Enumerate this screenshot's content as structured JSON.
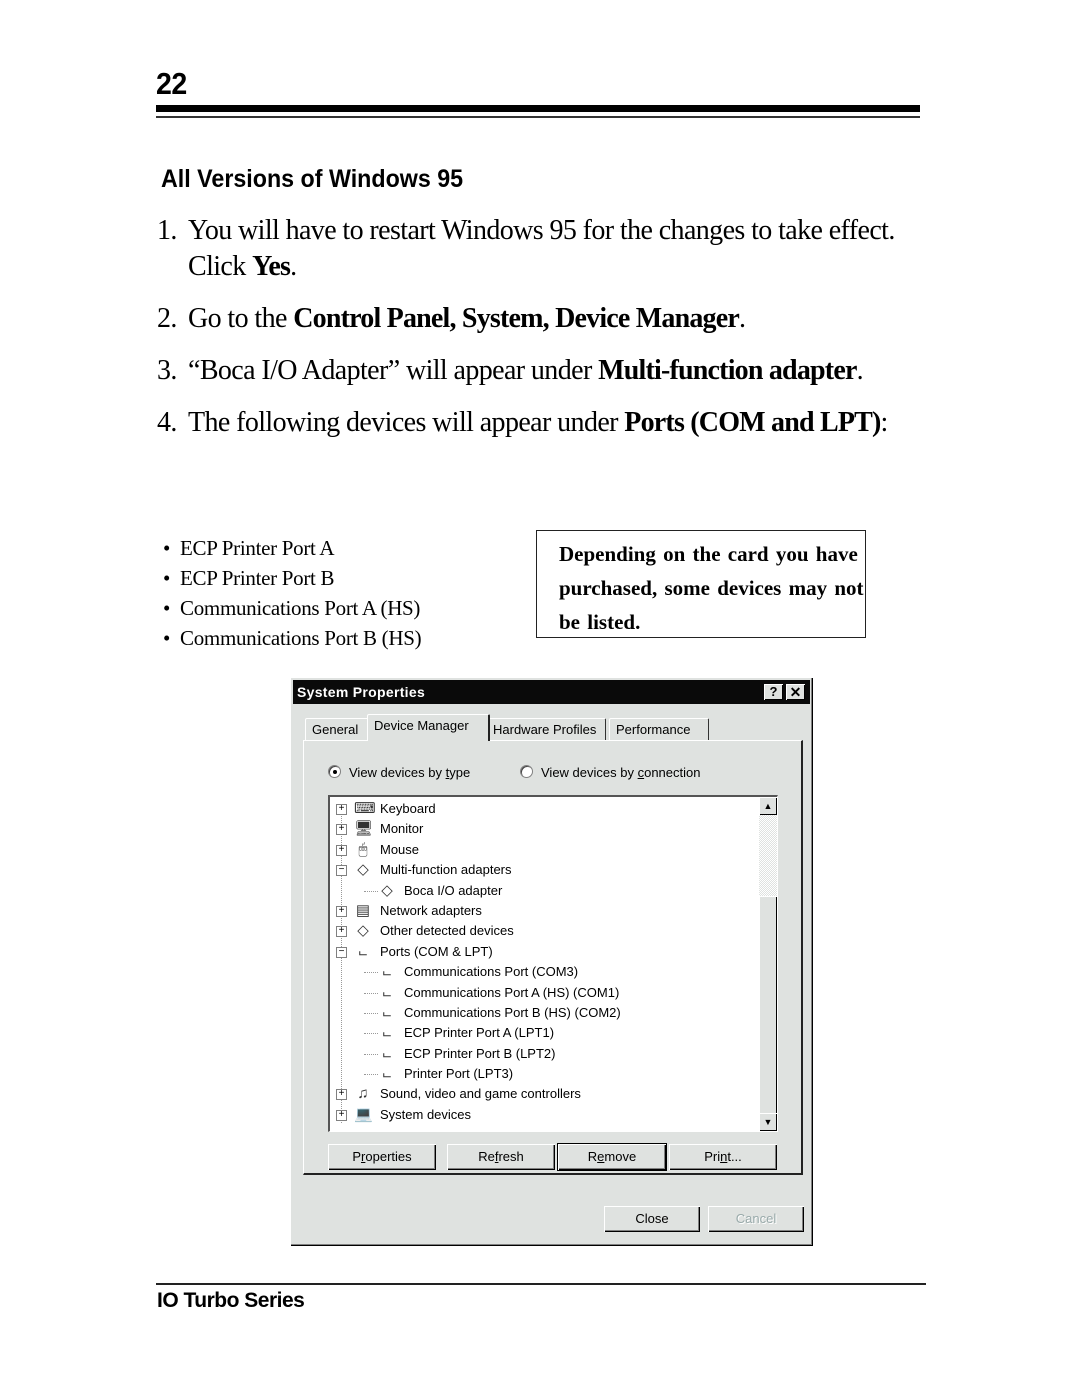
{
  "page": {
    "number": "22",
    "section_heading": "All Versions of Windows 95",
    "footer": "IO Turbo Series"
  },
  "steps": [
    {
      "num": "1.",
      "text_before": "You will have to restart Windows 95 for the changes to take effect. Click ",
      "bold": "Yes",
      "text_after": "."
    },
    {
      "num": "2.",
      "text_before": "Go to the ",
      "bold": "Control Panel, System, Device Manager",
      "text_after": "."
    },
    {
      "num": "3.",
      "text_before": "“Boca I/O Adapter” will appear under ",
      "bold": "Multi-function adapter",
      "text_after": "."
    },
    {
      "num": "4.",
      "text_before": "The following devices will appear under ",
      "bold": "Ports (COM and LPT)",
      "text_after": ":"
    }
  ],
  "bullets": [
    "ECP Printer Port A",
    "ECP Printer Port B",
    "Communications Port A (HS)",
    "Communications Port B (HS)"
  ],
  "note": "Depending on the card you have purchased, some devices may not be listed.",
  "dialog": {
    "title": "System Properties",
    "help_button": "?",
    "close_button": "✕",
    "tabs": [
      "General",
      "Device Manager",
      "Hardware Profiles",
      "Performance"
    ],
    "active_tab": "Device Manager",
    "radio_type": {
      "pre": "View devices by ",
      "u": "t",
      "post": "ype",
      "checked": true
    },
    "radio_connection": {
      "pre": "View devices by ",
      "u": "c",
      "post": "onnection",
      "checked": false
    },
    "tree": [
      {
        "label": "Keyboard",
        "level": 0,
        "expander": "+",
        "icon": "keyboard-icon",
        "glyph": "⌨"
      },
      {
        "label": "Monitor",
        "level": 0,
        "expander": "+",
        "icon": "monitor-icon",
        "glyph": "🖥"
      },
      {
        "label": "Mouse",
        "level": 0,
        "expander": "+",
        "icon": "mouse-icon",
        "glyph": "🖱"
      },
      {
        "label": "Multi-function adapters",
        "level": 0,
        "expander": "−",
        "icon": "adapter-diamond-icon",
        "glyph": "◇"
      },
      {
        "label": "Boca I/O adapter",
        "level": 1,
        "expander": "",
        "icon": "adapter-diamond-icon",
        "glyph": "◇"
      },
      {
        "label": "Network adapters",
        "level": 0,
        "expander": "+",
        "icon": "network-adapter-icon",
        "glyph": "▤"
      },
      {
        "label": "Other detected devices",
        "level": 0,
        "expander": "+",
        "icon": "unknown-device-icon",
        "glyph": "◇"
      },
      {
        "label": "Ports (COM & LPT)",
        "level": 0,
        "expander": "−",
        "icon": "port-icon",
        "glyph": "⨽"
      },
      {
        "label": "Communications Port (COM3)",
        "level": 1,
        "expander": "",
        "icon": "port-icon",
        "glyph": "⨽"
      },
      {
        "label": "Communications Port A (HS) (COM1)",
        "level": 1,
        "expander": "",
        "icon": "port-icon",
        "glyph": "⨽"
      },
      {
        "label": "Communications Port B (HS) (COM2)",
        "level": 1,
        "expander": "",
        "icon": "port-icon",
        "glyph": "⨽"
      },
      {
        "label": "ECP Printer Port A (LPT1)",
        "level": 1,
        "expander": "",
        "icon": "port-icon",
        "glyph": "⨽"
      },
      {
        "label": "ECP Printer Port B (LPT2)",
        "level": 1,
        "expander": "",
        "icon": "port-icon",
        "glyph": "⨽"
      },
      {
        "label": "Printer Port (LPT3)",
        "level": 1,
        "expander": "",
        "icon": "port-icon",
        "glyph": "⨽"
      },
      {
        "label": "Sound, video and game controllers",
        "level": 0,
        "expander": "+",
        "icon": "sound-controller-icon",
        "glyph": "♫"
      },
      {
        "label": "System devices",
        "level": 0,
        "expander": "+",
        "icon": "computer-icon",
        "glyph": "💻"
      }
    ],
    "scroll_up": "▲",
    "scroll_down": "▼",
    "buttons": {
      "properties": {
        "pre": "P",
        "u": "r",
        "post": "operties"
      },
      "refresh": {
        "pre": "Re",
        "u": "f",
        "post": "resh"
      },
      "remove": {
        "pre": "R",
        "u": "e",
        "post": "move"
      },
      "print": {
        "pre": "Pri",
        "u": "n",
        "post": "t..."
      },
      "close": "Close",
      "cancel": "Cancel"
    }
  }
}
